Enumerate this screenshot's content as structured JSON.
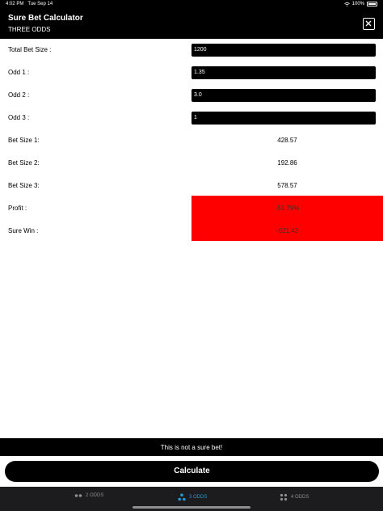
{
  "status_bar": {
    "time": "4:02 PM",
    "date": "Tue Sep 14",
    "battery": "100%"
  },
  "header": {
    "title": "Sure Bet Calculator",
    "subtitle": "THREE ODDS"
  },
  "inputs": [
    {
      "label": "Total Bet Size :",
      "value": "1200"
    },
    {
      "label": "Odd 1 :",
      "value": "1.35"
    },
    {
      "label": "Odd 2 :",
      "value": "3.0"
    },
    {
      "label": "Odd 3 :",
      "value": "1"
    }
  ],
  "bet_sizes": [
    {
      "label": "Bet Size 1:",
      "value": "428.57"
    },
    {
      "label": "Bet Size 2:",
      "value": "192.86"
    },
    {
      "label": "Bet Size 3:",
      "value": "578.57"
    }
  ],
  "profit": {
    "label": "Profit :",
    "value": "-51.79%"
  },
  "sure_win": {
    "label": "Sure Win :",
    "value": "-621.43"
  },
  "message": "This is not a sure bet!",
  "calculate_label": "Calculate",
  "tabs": [
    {
      "label": "2 ODDS",
      "active": false
    },
    {
      "label": "3 ODDS",
      "active": true
    },
    {
      "label": "4 ODDS",
      "active": false
    }
  ],
  "colors": {
    "result_bg": "#ff0000",
    "active_tab": "#1e9bd7",
    "tab_bar": "#1c1c1e"
  }
}
